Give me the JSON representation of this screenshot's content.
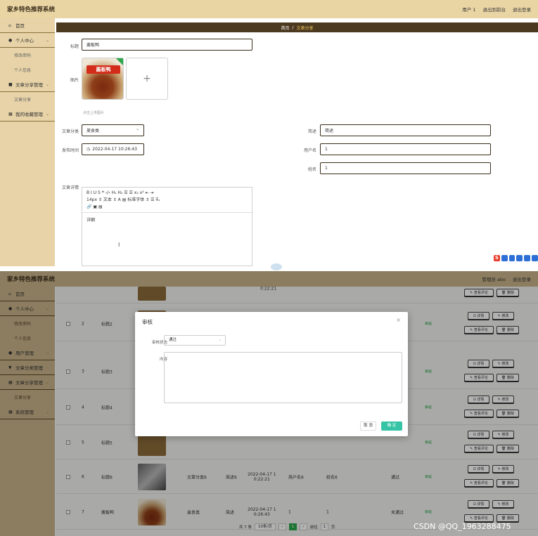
{
  "top": {
    "brand": "家乡特色推荐系统",
    "header_links": [
      "用户 1",
      "退出到前台",
      "退出登录"
    ],
    "sidebar": [
      {
        "icon": "home-icon",
        "glyph": "⌂",
        "label": "首页",
        "kind": "grp"
      },
      {
        "icon": "user-icon",
        "glyph": "●",
        "label": "个人中心",
        "kind": "grp",
        "chevron": true
      },
      {
        "label": "修改密码",
        "kind": "sub"
      },
      {
        "label": "个人信息",
        "kind": "sub"
      },
      {
        "icon": "article-icon",
        "glyph": "■",
        "label": "文章分享管理",
        "kind": "grp",
        "chevron": true
      },
      {
        "label": "文章分享",
        "kind": "sub"
      },
      {
        "icon": "grid-icon",
        "glyph": "▦",
        "label": "我的收藏管理",
        "kind": "grp",
        "chevron": true
      }
    ],
    "breadcrumb": {
      "home": "首页",
      "sep": "/",
      "current": "文章分享"
    },
    "form": {
      "title_label": "标题",
      "title_value": "酱板鸭",
      "image_label": "图片",
      "image_badge": "酱板鸭",
      "upload_hint": "点击上传图片",
      "category_label": "文章分类",
      "category_value": "美食类",
      "brief_label": "简述",
      "brief_value": "简述",
      "time_label": "发布时间",
      "time_value": "2022-04-17 10:26:43",
      "username_label": "用户名",
      "username_value": "1",
      "name_label": "姓名",
      "name_value": "1",
      "detail_label": "文章详情",
      "toolbar_lines": [
        "B  I  U  S    ❝  ‹/›    H₁  H₂    ☰  ☰    x₂  x²    ⇤  ⇥",
        "14px    ⇕     文本       ⇕   A   ▤     标准字体       ⇕    ☰    T̶ₓ",
        "🔗  ▣  ▤"
      ],
      "detail_value": "详细"
    }
  },
  "bottom": {
    "brand": "家乡特色推荐系统",
    "header_links": [
      "管理员 abo",
      "退出登录"
    ],
    "sidebar": [
      {
        "icon": "home-icon",
        "glyph": "⌂",
        "label": "首页",
        "kind": "grp"
      },
      {
        "icon": "user-icon",
        "glyph": "●",
        "label": "个人中心",
        "kind": "grp",
        "chevron": true
      },
      {
        "label": "修改密码",
        "kind": "sub"
      },
      {
        "label": "个人信息",
        "kind": "sub"
      },
      {
        "icon": "user-manage-icon",
        "glyph": "●",
        "label": "用户管理",
        "kind": "grp",
        "chevron": true
      },
      {
        "icon": "category-icon",
        "glyph": "▼",
        "label": "文章分类管理",
        "kind": "grp"
      },
      {
        "icon": "grid-icon",
        "glyph": "▦",
        "label": "文章分享管理",
        "kind": "grp",
        "chevron": true
      },
      {
        "label": "文章分享",
        "kind": "sub"
      },
      {
        "icon": "grid-icon",
        "glyph": "▦",
        "label": "系统管理",
        "kind": "grp",
        "chevron": true
      }
    ],
    "rows": [
      {
        "no": "",
        "title": "",
        "time": "0:22:21",
        "thumb": "brown",
        "partial": true
      },
      {
        "no": "2",
        "title": "标题2",
        "thumb": "brown"
      },
      {
        "no": "3",
        "title": "标题3"
      },
      {
        "no": "4",
        "title": "标题4"
      },
      {
        "no": "5",
        "title": "标题5",
        "thumb": "brown"
      },
      {
        "no": "6",
        "title": "标题6",
        "thumb": "dark",
        "category": "文章分类6",
        "brief": "简述6",
        "time": "2022-04-17 1\n0:22:21",
        "username": "用户名6",
        "name": "姓名6",
        "status": "通过"
      },
      {
        "no": "7",
        "title": "酱板鸭",
        "thumb": "food",
        "category": "美食类",
        "brief": "简述",
        "time": "2022-04-17 1\n0:26:43",
        "username": "1",
        "name": "1",
        "status": "未通过"
      }
    ],
    "row_action": "审核",
    "buttons": {
      "detail": "⊡ 详情",
      "edit": "✎ 修改",
      "comments": "✎ 查看评论",
      "delete": "🗑 删除"
    },
    "pagination": {
      "total": "共 7 条",
      "size": "10条/页",
      "current": "1",
      "goto": "前往",
      "goto_value": "1",
      "page_unit": "页"
    },
    "modal": {
      "title": "审核",
      "status_label": "审核状态",
      "status_value": "通过",
      "content_label": "内容",
      "cancel": "取 消",
      "confirm": "确 定"
    },
    "watermark": "CSDN @QQ_1963288475"
  }
}
